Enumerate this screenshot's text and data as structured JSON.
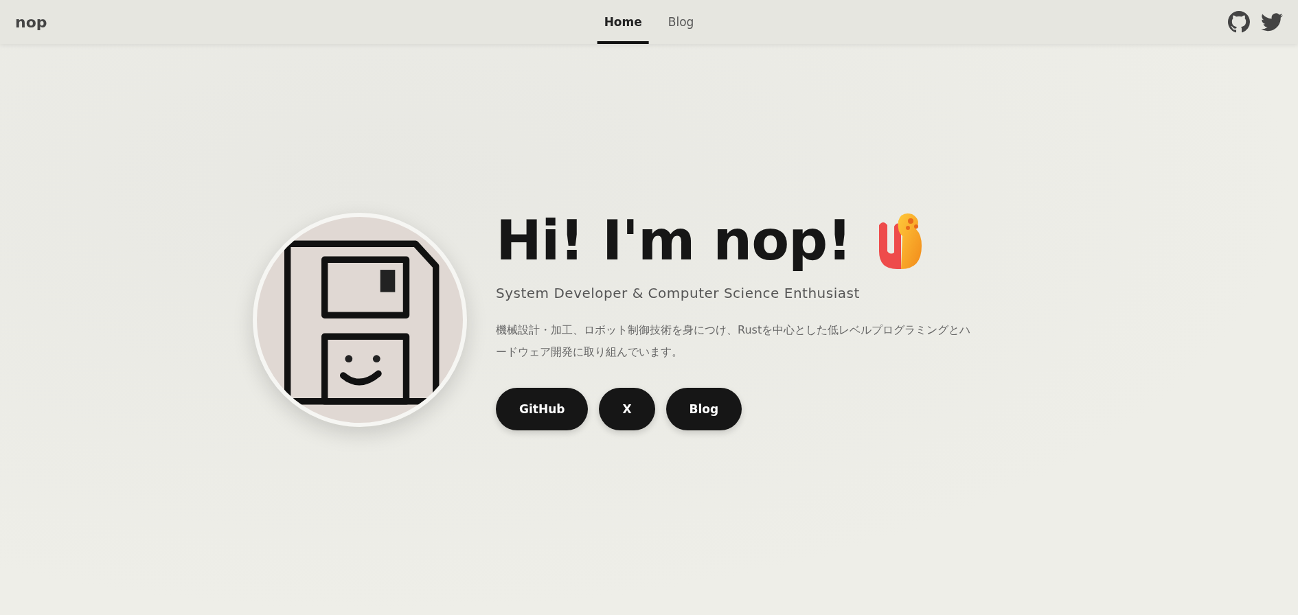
{
  "header": {
    "brand": "nop",
    "nav": [
      {
        "label": "Home",
        "selected": true
      },
      {
        "label": "Blog",
        "selected": false
      }
    ]
  },
  "hero": {
    "heading": "Hi! I'm nop!",
    "subtitle": "System Developer & Computer Science Enthusiast",
    "description": "機械設計・加工、ロボット制御技術を身につけ、Rustを中心とした低レベルプログラミングとハードウェア開発に取り組んでいます。",
    "buttons": [
      "GitHub",
      "X",
      "Blog"
    ]
  }
}
